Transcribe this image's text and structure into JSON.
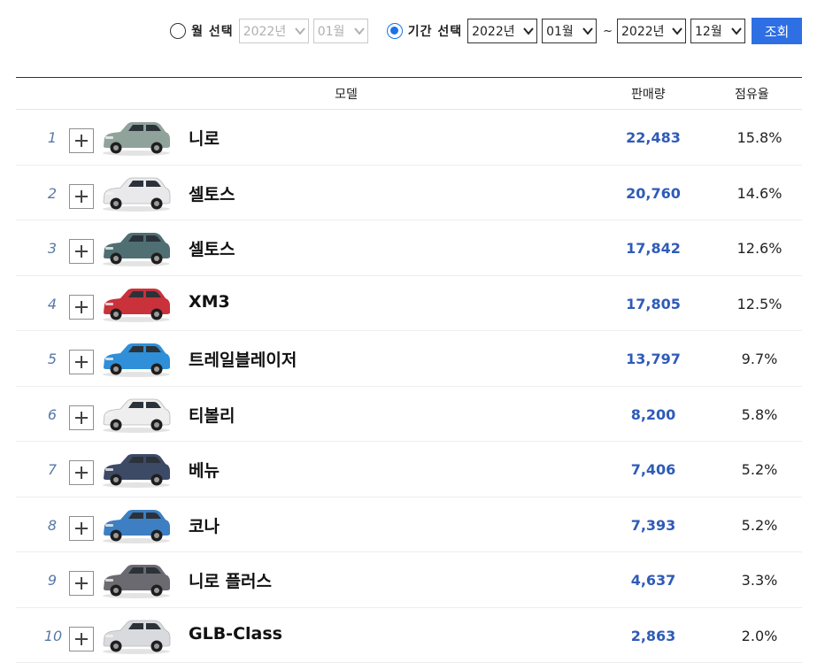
{
  "filters": {
    "month_select_label": "월 선택",
    "month_year": "2022년",
    "month_month": "01월",
    "period_select_label": "기간 선택",
    "period_from_year": "2022년",
    "period_from_month": "01월",
    "separator": "~",
    "period_to_year": "2022년",
    "period_to_month": "12월",
    "search_button": "조회",
    "selected": "period",
    "accent_color": "#2f6fe4"
  },
  "table": {
    "headers": {
      "model": "모델",
      "sales": "판매량",
      "share": "점유율"
    },
    "rows": [
      {
        "rank": "1",
        "model": "니로",
        "sales": "22,483",
        "share": "15.8%",
        "car_color": "#8fa39a"
      },
      {
        "rank": "2",
        "model": "셀토스",
        "sales": "20,760",
        "share": "14.6%",
        "car_color": "#e9e9ec"
      },
      {
        "rank": "3",
        "model": "셀토스",
        "sales": "17,842",
        "share": "12.6%",
        "car_color": "#4f6f73"
      },
      {
        "rank": "4",
        "model": "XM3",
        "sales": "17,805",
        "share": "12.5%",
        "car_color": "#c9323a"
      },
      {
        "rank": "5",
        "model": "트레일블레이저",
        "sales": "13,797",
        "share": "9.7%",
        "car_color": "#2f8fd8"
      },
      {
        "rank": "6",
        "model": "티볼리",
        "sales": "8,200",
        "share": "5.8%",
        "car_color": "#eeeeee"
      },
      {
        "rank": "7",
        "model": "베뉴",
        "sales": "7,406",
        "share": "5.2%",
        "car_color": "#3d4a66"
      },
      {
        "rank": "8",
        "model": "코나",
        "sales": "7,393",
        "share": "5.2%",
        "car_color": "#3d7fc2"
      },
      {
        "rank": "9",
        "model": "니로 플러스",
        "sales": "4,637",
        "share": "3.3%",
        "car_color": "#6a6a70"
      },
      {
        "rank": "10",
        "model": "GLB-Class",
        "sales": "2,863",
        "share": "2.0%",
        "car_color": "#d8dade"
      }
    ]
  }
}
